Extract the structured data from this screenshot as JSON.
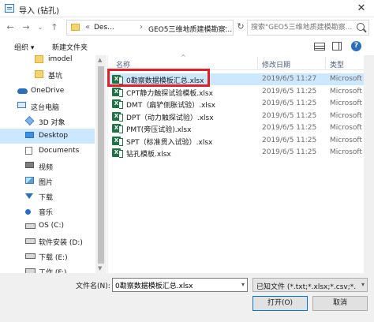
{
  "window": {
    "title": "导入 (钻孔)",
    "close": "✕"
  },
  "address": {
    "chevron": "«",
    "crumbs": [
      "Des...",
      "GEO5三维地质建模勘察..."
    ],
    "sep": "›"
  },
  "search": {
    "placeholder": "搜索\"GEO5三维地质建模勘察..."
  },
  "toolbar": {
    "organize": "组织 ▾",
    "new_folder": "新建文件夹"
  },
  "sidebar": {
    "items": [
      {
        "label": "imodel",
        "icon": "folder-icon"
      },
      {
        "label": "基坑",
        "icon": "folder-icon"
      },
      {
        "label": "OneDrive",
        "icon": "onedrive-icon"
      },
      {
        "label": "这台电脑",
        "icon": "pc-icon"
      },
      {
        "label": "3D 对象",
        "icon": "cube-icon"
      },
      {
        "label": "Desktop",
        "icon": "desktop-icon",
        "selected": true
      },
      {
        "label": "Documents",
        "icon": "doc-icon"
      },
      {
        "label": "视频",
        "icon": "video-icon"
      },
      {
        "label": "图片",
        "icon": "image-icon"
      },
      {
        "label": "下载",
        "icon": "download-icon"
      },
      {
        "label": "音乐",
        "icon": "music-icon"
      },
      {
        "label": "OS (C:)",
        "icon": "drive-icon"
      },
      {
        "label": "软件安装 (D:)",
        "icon": "drive-icon"
      },
      {
        "label": "下载 (E:)",
        "icon": "drive-icon"
      },
      {
        "label": "工作 (F:)",
        "icon": "drive-icon"
      }
    ]
  },
  "columns": {
    "name": "名称",
    "date": "修改日期",
    "type": "类型"
  },
  "files": [
    {
      "name": "0勘察数据模板汇总.xlsx",
      "date": "2019/6/5 11:27",
      "type": "Microsoft Ex",
      "selected": true
    },
    {
      "name": "CPT静力触探试验模板.xlsx",
      "date": "2019/6/5 11:25",
      "type": "Microsoft Ex"
    },
    {
      "name": "DMT（扁铲侧胀试验）.xlsx",
      "date": "2019/6/5 11:25",
      "type": "Microsoft Ex"
    },
    {
      "name": "DPT（动力触探试验）.xlsx",
      "date": "2019/6/5 11:25",
      "type": "Microsoft Ex"
    },
    {
      "name": "PMT(旁压试验).xlsx",
      "date": "2019/6/5 11:25",
      "type": "Microsoft Ex"
    },
    {
      "name": "SPT（标准贯入试验）.xlsx",
      "date": "2019/6/5 11:25",
      "type": "Microsoft Ex"
    },
    {
      "name": "钻孔模板.xlsx",
      "date": "2019/6/5 11:25",
      "type": "Microsoft Ex"
    }
  ],
  "footer": {
    "filename_label": "文件名(N):",
    "filename_value": "0勘察数据模板汇总.xlsx",
    "filter_value": "已知文件 (*.txt;*.xlsx;*.csv;*.od",
    "open_label": "打开(O)",
    "cancel_label": "取消"
  },
  "colors": {
    "highlight": "#e0202a",
    "selection": "#cce8ff",
    "excel": "#1f7244"
  }
}
